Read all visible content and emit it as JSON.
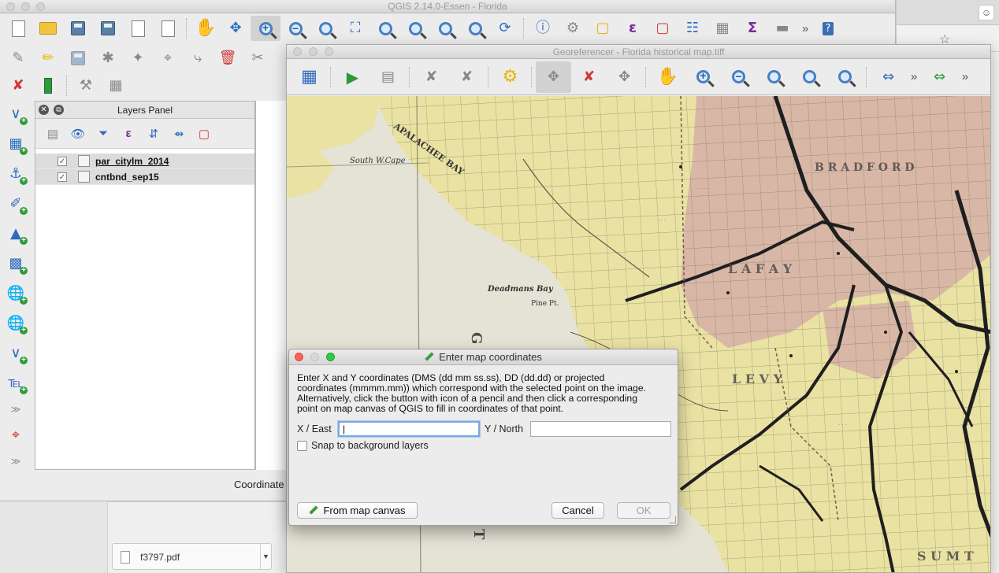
{
  "qgis": {
    "title": "QGIS 2.14.0-Essen - Florida",
    "layers_panel": {
      "title": "Layers Panel",
      "layers": [
        {
          "name": "par_citylm_2014",
          "checked": true
        },
        {
          "name": "cntbnd_sep15",
          "checked": true
        }
      ]
    },
    "coordinate_label": "Coordinate"
  },
  "georeferencer": {
    "title": "Georeferencer - Florida historical map.tiff",
    "map_labels": {
      "south_w_cape": "South W.Cape",
      "apalachee_bay": "APALACHEE BAY",
      "deadmans_bay": "Deadmans Bay",
      "pine_pt": "Pine Pt.",
      "lafayette": "L A F A Y",
      "levy": "L E V Y",
      "bradford": "B R A D F O R D",
      "sumter": "S U M T"
    }
  },
  "dialog": {
    "title": "Enter map coordinates",
    "instructions_lines": [
      "Enter X and Y coordinates (DMS (dd mm ss.ss), DD (dd.dd) or projected",
      "coordinates (mmmm.mm)) which correspond with the selected point on the image.",
      "Alternatively, click the button with icon of a pencil and then click a corresponding",
      "point on map canvas of QGIS to fill in coordinates of that point."
    ],
    "x_label": "X / East",
    "x_value": "|",
    "y_label": "Y / North",
    "y_value": "",
    "snap_label": "Snap to background layers",
    "snap_checked": false,
    "from_map_canvas_label": "From map canvas",
    "cancel_label": "Cancel",
    "ok_label": "OK"
  },
  "downloads": {
    "file_name": "f3797.pdf"
  },
  "colors": {
    "water": "#e3e3d6",
    "land_yellow": "#e8e2a0",
    "land_pink": "#d6b3a3",
    "railroad": "#1f1f1f",
    "grid": "#6f6a55"
  }
}
